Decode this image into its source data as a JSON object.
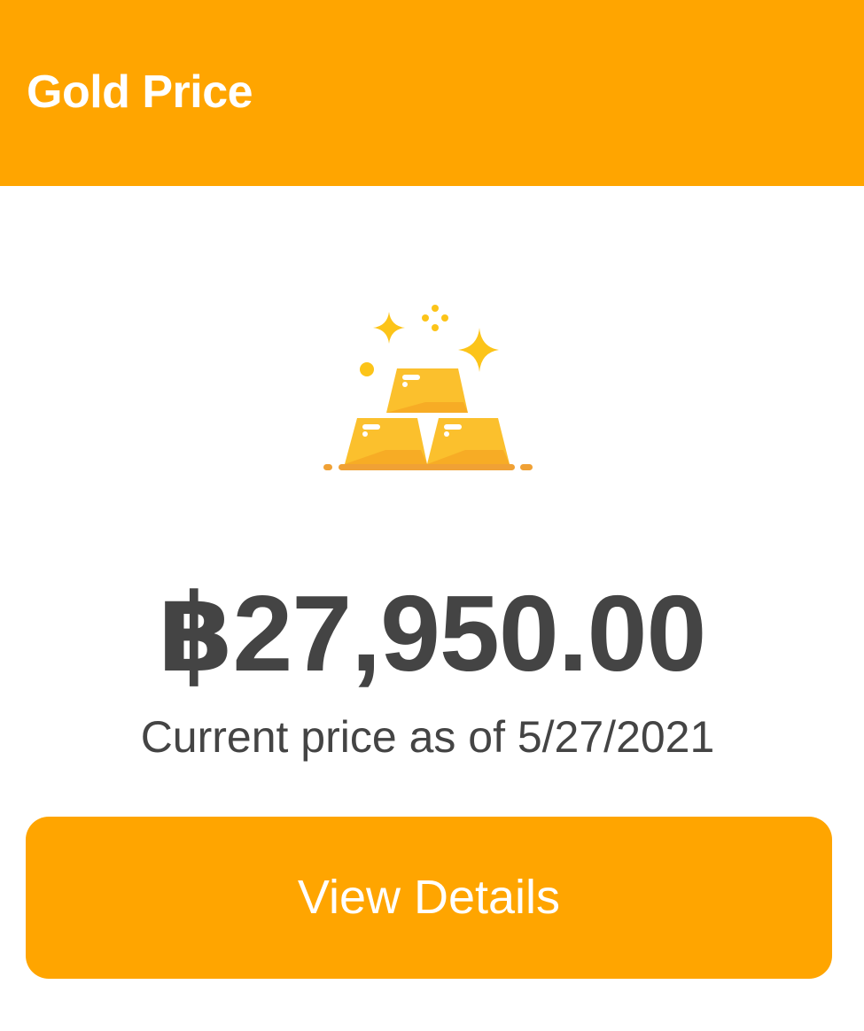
{
  "header": {
    "title": "Gold Price",
    "background_color": "#ffa500"
  },
  "illustration": {
    "icon": "gold-bars-icon"
  },
  "price": {
    "value": "฿27,950.00",
    "caption": "Current price as of 5/27/2021",
    "text_color": "#444444"
  },
  "actions": {
    "view_details_label": "View Details",
    "button_color": "#ffa500"
  }
}
